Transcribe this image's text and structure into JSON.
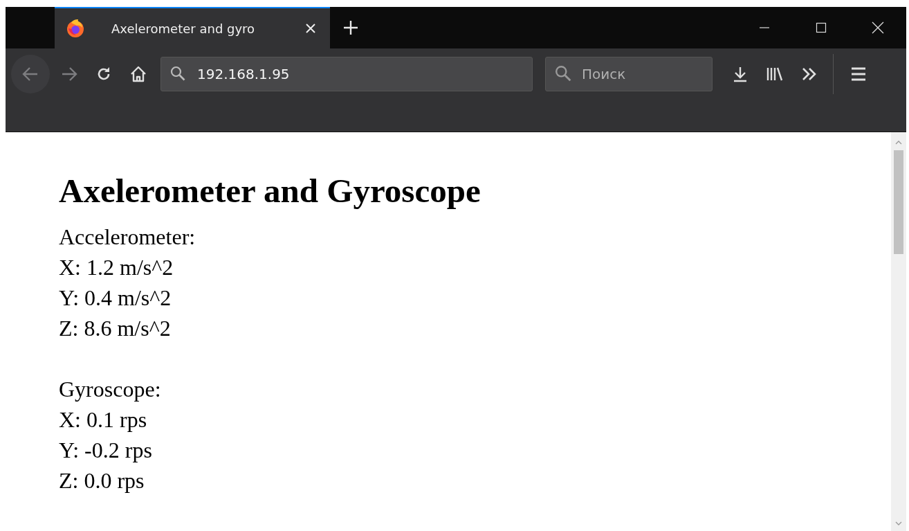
{
  "tabs": [
    {
      "title": "Axelerometer and gyro",
      "selected": true
    }
  ],
  "address_bar": {
    "value": "192.168.1.95"
  },
  "search": {
    "placeholder": "Поиск"
  },
  "page": {
    "heading": "Axelerometer and Gyroscope",
    "sections": [
      {
        "title": "Accelerometer:",
        "lines": [
          "X: 1.2 m/s^2",
          "Y: 0.4 m/s^2",
          "Z: 8.6 m/s^2"
        ]
      },
      {
        "title": "Gyroscope:",
        "lines": [
          "X: 0.1 rps",
          "Y: -0.2 rps",
          "Z: 0.0 rps"
        ]
      }
    ]
  }
}
